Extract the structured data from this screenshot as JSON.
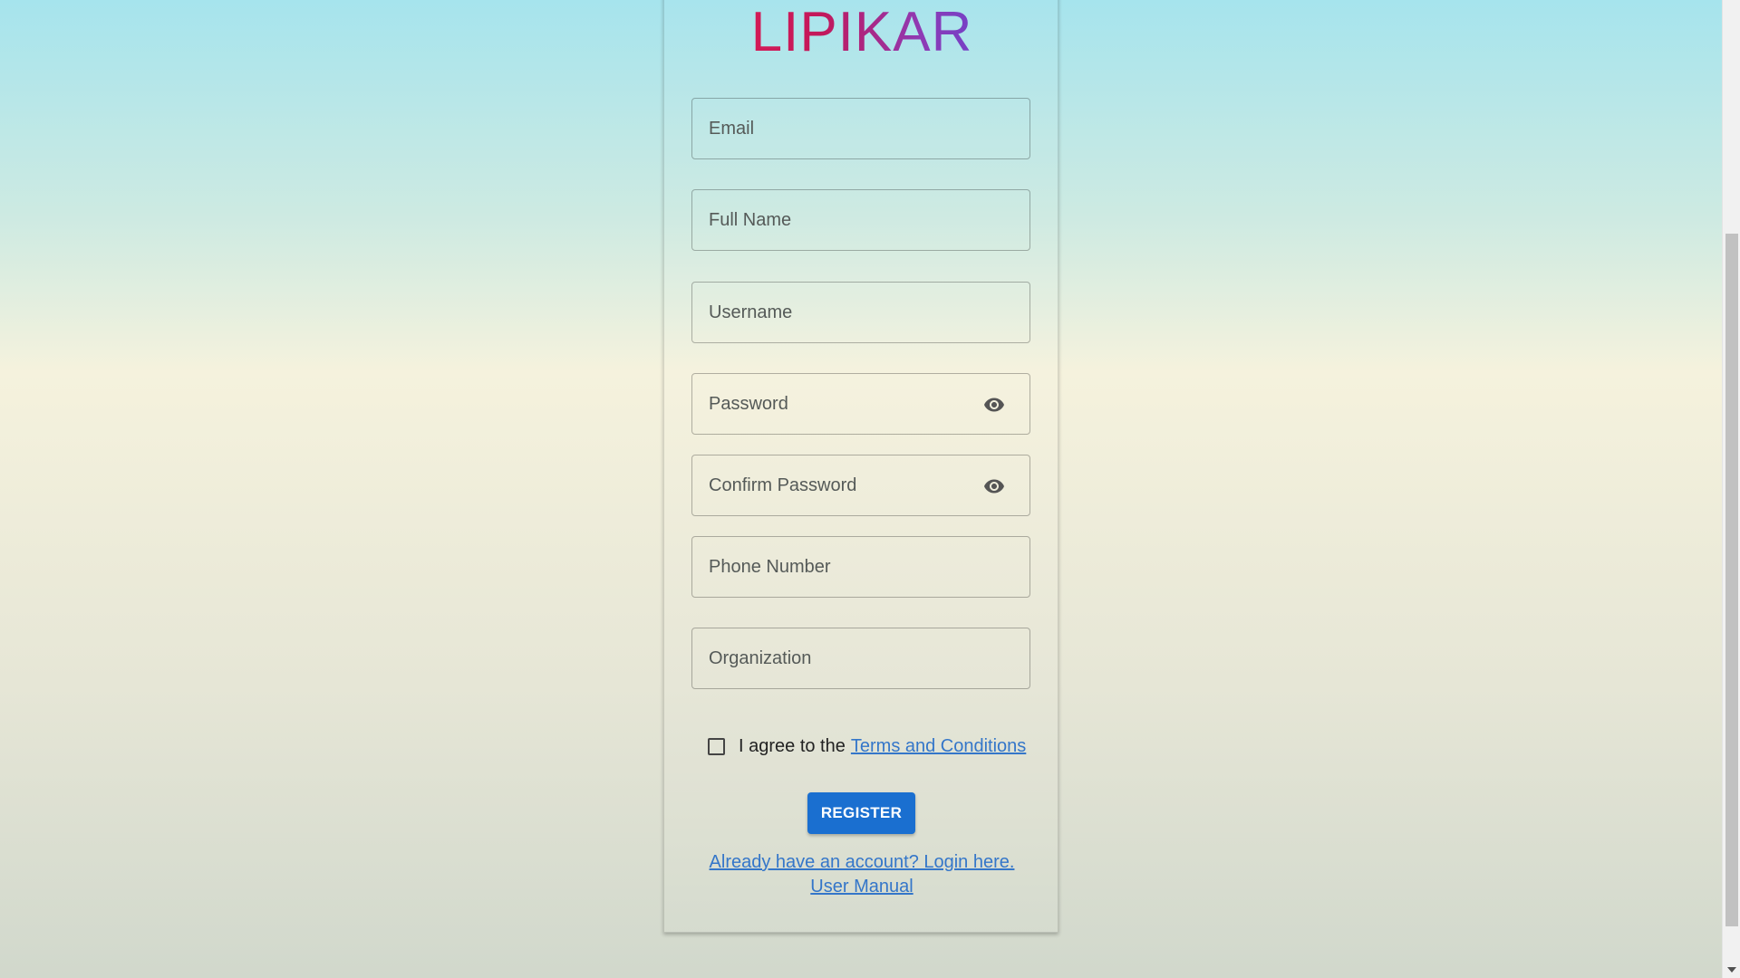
{
  "app": {
    "logo_text": "LIPIKAR"
  },
  "form": {
    "fields": {
      "email": {
        "placeholder": "Email",
        "value": ""
      },
      "full_name": {
        "placeholder": "Full Name",
        "value": ""
      },
      "username": {
        "placeholder": "Username",
        "value": ""
      },
      "password": {
        "placeholder": "Password",
        "value": ""
      },
      "confirm_password": {
        "placeholder": "Confirm Password",
        "value": ""
      },
      "phone_number": {
        "placeholder": "Phone Number",
        "value": ""
      },
      "organization": {
        "placeholder": "Organization",
        "value": ""
      }
    },
    "icons": {
      "password_toggle": "eye-icon",
      "confirm_password_toggle": "eye-icon"
    },
    "agree": {
      "checked": false,
      "prefix": "I agree to the",
      "link_text": "Terms and Conditions"
    },
    "register_label": "REGISTER",
    "login_link": "Already have an account? Login here.",
    "manual_link": "User Manual"
  },
  "colors": {
    "logo_start": "#e91e50",
    "logo_end": "#4b4ce3",
    "primary_button": "#1a6fd0",
    "link": "#3476c9"
  }
}
